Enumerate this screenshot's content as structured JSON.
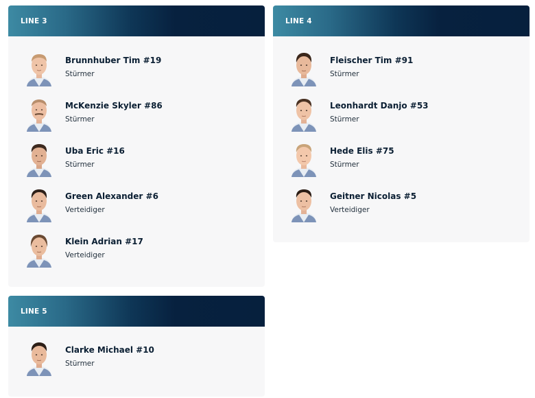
{
  "lines": [
    {
      "title": "LINE 3",
      "players": [
        {
          "name": "Brunnhuber Tim #19",
          "role": "Stürmer"
        },
        {
          "name": "McKenzie Skyler #86",
          "role": "Stürmer"
        },
        {
          "name": "Uba Eric #16",
          "role": "Stürmer"
        },
        {
          "name": "Green Alexander #6",
          "role": "Verteidiger"
        },
        {
          "name": "Klein Adrian #17",
          "role": "Verteidiger"
        }
      ]
    },
    {
      "title": "LINE 4",
      "players": [
        {
          "name": "Fleischer Tim #91",
          "role": "Stürmer"
        },
        {
          "name": "Leonhardt Danjo #53",
          "role": "Stürmer"
        },
        {
          "name": "Hede Elis #75",
          "role": "Stürmer"
        },
        {
          "name": "Geitner Nicolas #5",
          "role": "Verteidiger"
        }
      ]
    },
    {
      "title": "LINE 5",
      "players": [
        {
          "name": "Clarke Michael #10",
          "role": "Stürmer"
        }
      ]
    }
  ],
  "colors": {
    "card_background": "#f7f7f8",
    "header_gradient_start": "#3d8aa3",
    "header_gradient_end": "#06203d",
    "name_text": "#0b1f33"
  },
  "icons": {
    "avatar": "player-portrait-icon"
  }
}
